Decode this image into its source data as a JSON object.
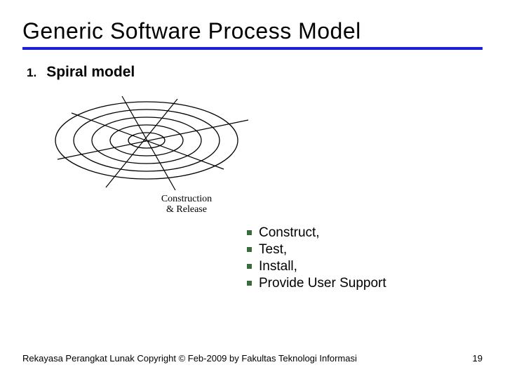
{
  "title": "Generic Software Process Model",
  "list": {
    "number": "1.",
    "label": "Spiral model"
  },
  "spiral_caption": {
    "line1": "Construction",
    "line2": "& Release"
  },
  "bullets": [
    "Construct,",
    "Test,",
    "Install,",
    "Provide User Support"
  ],
  "footer": "Rekayasa Perangkat Lunak Copyright © Feb-2009 by Fakultas Teknologi Informasi",
  "page_number": "19"
}
